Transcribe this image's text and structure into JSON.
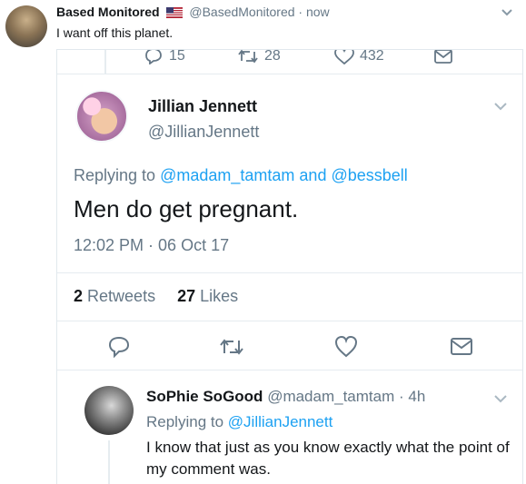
{
  "outer_tweet": {
    "name": "Based Monitored",
    "flag_icon": "us-flag-icon",
    "handle": "@BasedMonitored",
    "dot": "·",
    "time": "now",
    "text": "I want off this planet."
  },
  "embedded": {
    "top_action_counts": {
      "replies": "15",
      "retweets": "28",
      "likes": "432"
    },
    "main_tweet": {
      "name": "Jillian Jennett",
      "handle": "@JillianJennett",
      "replying_prefix": "Replying to",
      "replying_user1": "@madam_tamtam",
      "replying_and": "and",
      "replying_user2": "@bessbell",
      "text": "Men do get pregnant.",
      "timestamp": "12:02 PM · 06 Oct 17",
      "retweets_count": "2",
      "retweets_label": "Retweets",
      "likes_count": "27",
      "likes_label": "Likes"
    },
    "reply_tweet": {
      "name": "SoPhie SoGood",
      "handle": "@madam_tamtam",
      "dot": "·",
      "time": "4h",
      "replying_prefix": "Replying to",
      "replying_user": "@JillianJennett",
      "text": "I know that just as you know exactly what the point of my comment was."
    }
  },
  "colors": {
    "link": "#1da1f2",
    "muted": "#657786",
    "text": "#14171a",
    "border": "#e6ecf0"
  },
  "icons": [
    "reply-icon",
    "retweet-icon",
    "like-icon",
    "message-icon",
    "chevron-down-icon",
    "us-flag-icon"
  ]
}
